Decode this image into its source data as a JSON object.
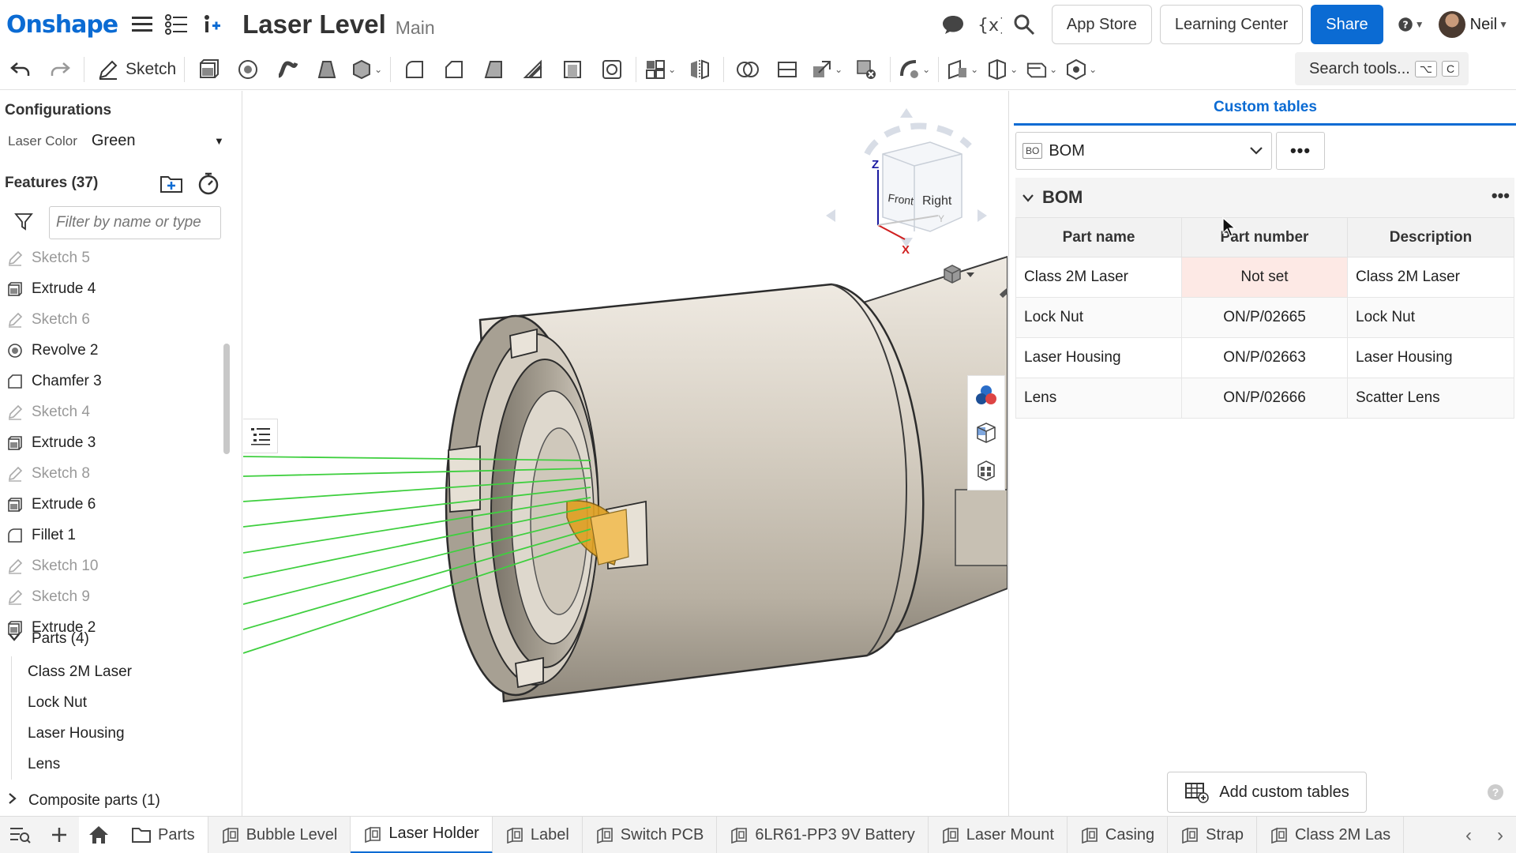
{
  "app": {
    "logo": "Onshape",
    "document_title": "Laser Level",
    "branch": "Main",
    "buttons": {
      "app_store": "App Store",
      "learning_center": "Learning Center",
      "share": "Share"
    },
    "user_name": "Neil",
    "brand_color": "#0b6bd3"
  },
  "toolbar": {
    "sketch_label": "Sketch",
    "search_label": "Search tools...",
    "search_kbd_1": "⌥",
    "search_kbd_2": "C"
  },
  "left_panel": {
    "configurations_title": "Configurations",
    "config_label": "Laser Color",
    "config_value": "Green",
    "features_title": "Features (37)",
    "filter_placeholder": "Filter by name or type",
    "features": [
      {
        "label": "Sketch 5",
        "type": "sketch"
      },
      {
        "label": "Extrude 4",
        "type": "extrude"
      },
      {
        "label": "Sketch 6",
        "type": "sketch"
      },
      {
        "label": "Revolve 2",
        "type": "revolve"
      },
      {
        "label": "Chamfer 3",
        "type": "chamfer"
      },
      {
        "label": "Sketch 4",
        "type": "sketch"
      },
      {
        "label": "Extrude 3",
        "type": "extrude"
      },
      {
        "label": "Sketch 8",
        "type": "sketch"
      },
      {
        "label": "Extrude 6",
        "type": "extrude"
      },
      {
        "label": "Fillet 1",
        "type": "fillet"
      },
      {
        "label": "Sketch 10",
        "type": "sketch"
      },
      {
        "label": "Sketch 9",
        "type": "sketch"
      },
      {
        "label": "Extrude 2",
        "type": "extrude"
      }
    ],
    "parts_title": "Parts (4)",
    "parts": [
      "Class 2M Laser",
      "Lock Nut",
      "Laser Housing",
      "Lens"
    ],
    "composite_title": "Composite parts (1)"
  },
  "viewcube": {
    "front": "Front",
    "right": "Right",
    "axis_z": "Z",
    "axis_x": "X",
    "axis_y": "Y"
  },
  "right_panel": {
    "header": "Custom tables",
    "selected_table": "BOM",
    "table_tag": "BO",
    "more": "•••",
    "bom_title": "BOM",
    "columns": [
      "Part name",
      "Part number",
      "Description"
    ],
    "rows": [
      [
        "Class 2M Laser",
        "Not set",
        "Class 2M Laser"
      ],
      [
        "Lock Nut",
        "ON/P/02665",
        "Lock Nut"
      ],
      [
        "Laser Housing",
        "ON/P/02663",
        "Laser Housing"
      ],
      [
        "Lens",
        "ON/P/02666",
        "Scatter Lens"
      ]
    ],
    "add_button": "Add custom tables"
  },
  "bottom_tabs": {
    "parts_tab": "Parts",
    "tabs": [
      "Bubble Level",
      "Laser Holder",
      "Label",
      "Switch PCB",
      "6LR61-PP3 9V Battery",
      "Laser Mount",
      "Casing",
      "Strap",
      "Class 2M Las"
    ],
    "active_tab": "Laser Holder"
  },
  "colors": {
    "laser_green": "#3fcf3f",
    "part_tan": "#d9d2c5",
    "lens_orange": "#e0a020",
    "not_set_bg": "#fde9e5"
  }
}
